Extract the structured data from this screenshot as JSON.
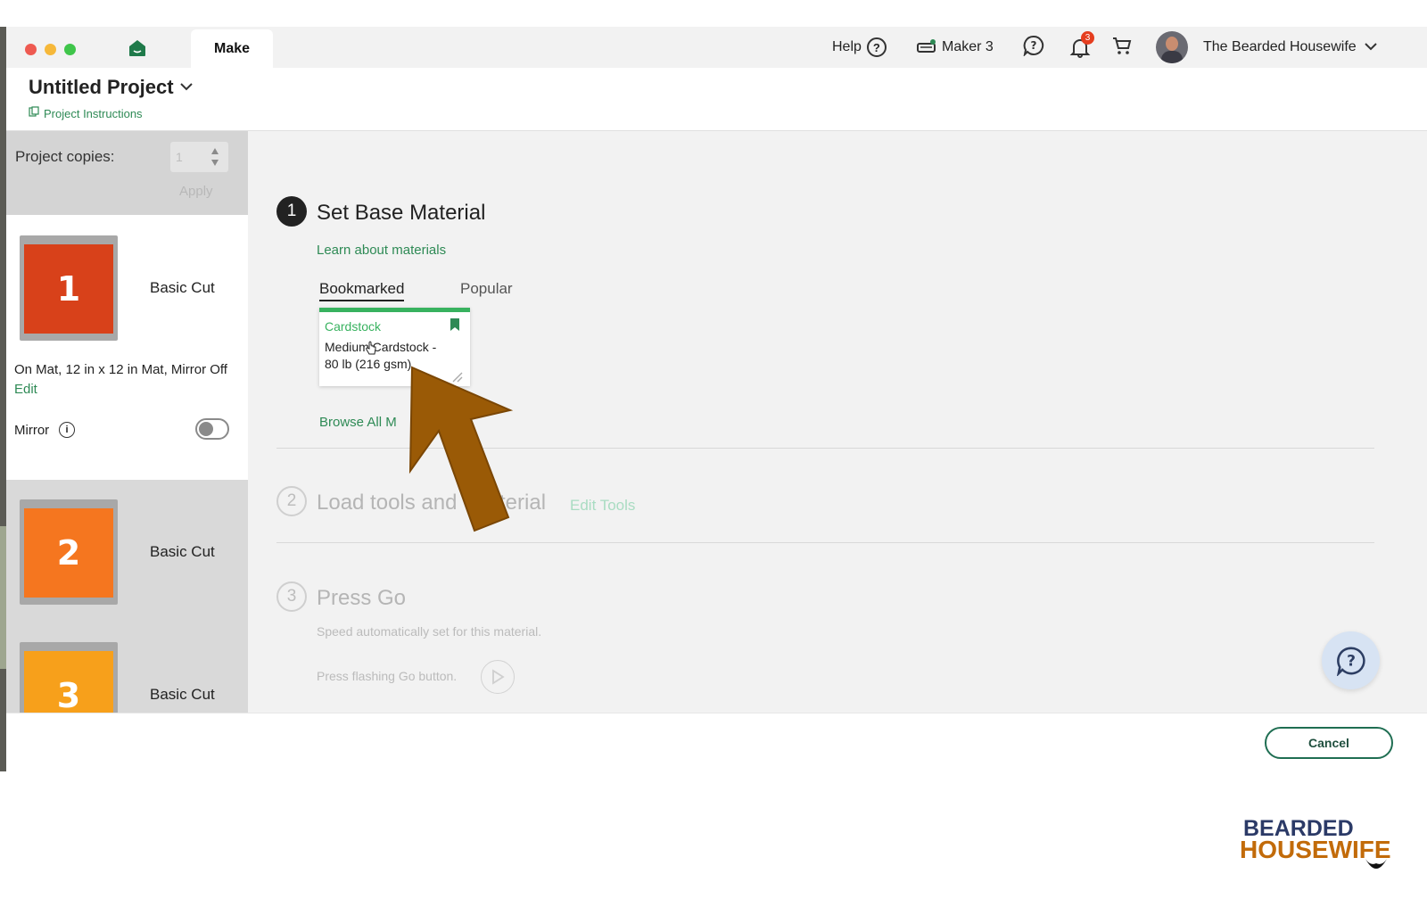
{
  "titlebar": {
    "tab_label": "Make",
    "help_label": "Help",
    "machine_label": "Maker 3",
    "notification_count": "3",
    "user_name": "The Bearded Housewife"
  },
  "header": {
    "project_title": "Untitled Project",
    "instructions_link": "Project Instructions"
  },
  "sidebar": {
    "copies_label": "Project copies:",
    "copies_value": "1",
    "apply_label": "Apply",
    "mats": [
      {
        "number": "1",
        "label": "Basic Cut",
        "color": "#d8411a"
      },
      {
        "number": "2",
        "label": "Basic Cut",
        "color": "#f5761f"
      },
      {
        "number": "3",
        "label": "Basic Cut",
        "color": "#f7a01b"
      }
    ],
    "mat_info": "On Mat, 12 in x 12 in Mat, Mirror Off",
    "edit_label": "Edit",
    "mirror_label": "Mirror"
  },
  "steps": {
    "step1": {
      "number": "1",
      "title": "Set Base Material",
      "learn_link": "Learn about materials",
      "tab_bookmarked": "Bookmarked",
      "tab_popular": "Popular",
      "card_category": "Cardstock",
      "card_name_line1": "Medium Cardstock -",
      "card_name_line2": "80 lb (216 gsm)",
      "browse_link": "Browse All M"
    },
    "step2": {
      "number": "2",
      "title_part1": "Load tools and",
      "title_part2": "terial",
      "edit_tools": "Edit Tools"
    },
    "step3": {
      "number": "3",
      "title": "Press Go",
      "speed_text": "Speed automatically set for this material.",
      "press_text": "Press flashing Go button."
    }
  },
  "footer": {
    "cancel_label": "Cancel"
  },
  "watermark": {
    "line1": "BEARDED",
    "line2": "HOUSEWIFE"
  },
  "colors": {
    "accent_green": "#2e8a55",
    "card_green": "#38b25f",
    "arrow_brown": "#9a5a06",
    "notification_red": "#e53e1f"
  }
}
